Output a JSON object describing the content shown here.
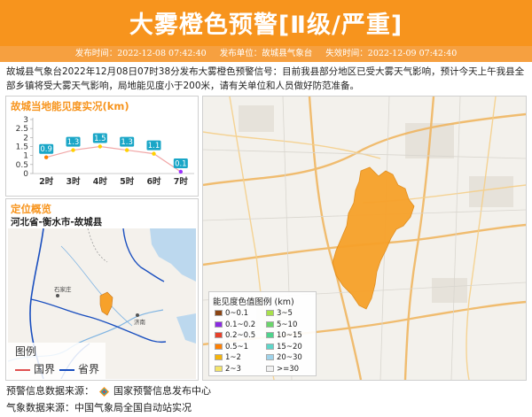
{
  "header": {
    "title": "大雾橙色预警[Ⅱ级/严重]",
    "publish_time": "发布时间：2022-12-08 07:42:40",
    "publisher": "发布单位：故城县气象台",
    "expire_time": "失效时间：2022-12-09 07:42:40",
    "color": "#f7941d"
  },
  "description": "故城县气象台2022年12月08日07时38分发布大雾橙色预警信号：目前我县部分地区已受大雾天气影响，预计今天上午我县全部乡镇将受大雾天气影响，局地能见度小于200米，请有关单位和人员做好防范准备。",
  "visibility_panel": {
    "title": "故城当地能见度实况(km)"
  },
  "chart_data": {
    "type": "line",
    "title": "故城当地能见度实况(km)",
    "categories": [
      "2时",
      "3时",
      "4时",
      "5时",
      "6时",
      "7时"
    ],
    "values": [
      0.9,
      1.3,
      1.5,
      1.3,
      1.1,
      0.1
    ],
    "ylim": [
      0,
      3
    ],
    "yticks": [
      "0",
      "0.5",
      "1",
      "1.5",
      "2",
      "2.5",
      "3"
    ],
    "line_color": "#f1a7a7",
    "label_color": "#1aa6c7",
    "point_colors": [
      "#ff7f00",
      "#ffd100",
      "#ffd100",
      "#ffd100",
      "#ffd100",
      "#9b30ff"
    ]
  },
  "location_panel": {
    "title": "定位概览",
    "subtitle": "河北省-衡水市-故城县",
    "inset_map": {
      "label_shijiazhuang": "石家庄",
      "label_jinan": "济南",
      "legend_title": "图例",
      "legend_country": "国界",
      "legend_province": "省界",
      "country_color": "#e05050",
      "province_color": "#1a4fbf"
    }
  },
  "map_panel": {
    "legend_title": "能见度色值图例 (km)",
    "legend": [
      {
        "label": "0~0.1",
        "color": "#8b4513"
      },
      {
        "label": "3~5",
        "color": "#a8e04a"
      },
      {
        "label": "0.1~0.2",
        "color": "#8a2be2"
      },
      {
        "label": "5~10",
        "color": "#6ad56a"
      },
      {
        "label": "0.2~0.5",
        "color": "#e8402a"
      },
      {
        "label": "10~15",
        "color": "#4fd38c"
      },
      {
        "label": "0.5~1",
        "color": "#ff7f00"
      },
      {
        "label": "15~20",
        "color": "#5fd6c9"
      },
      {
        "label": "1~2",
        "color": "#f5b40a"
      },
      {
        "label": "20~30",
        "color": "#9fd3ea"
      },
      {
        "label": "2~3",
        "color": "#f3e46a"
      },
      {
        "label": ">=30",
        "color": "#f2f2f2"
      }
    ],
    "region_color": "#f7a12a"
  },
  "footer": {
    "warning_source_label": "预警信息数据来源：",
    "warning_source": "国家预警信息发布中心",
    "weather_source": "气象数据来源：中国气象局全国自动站实况"
  }
}
